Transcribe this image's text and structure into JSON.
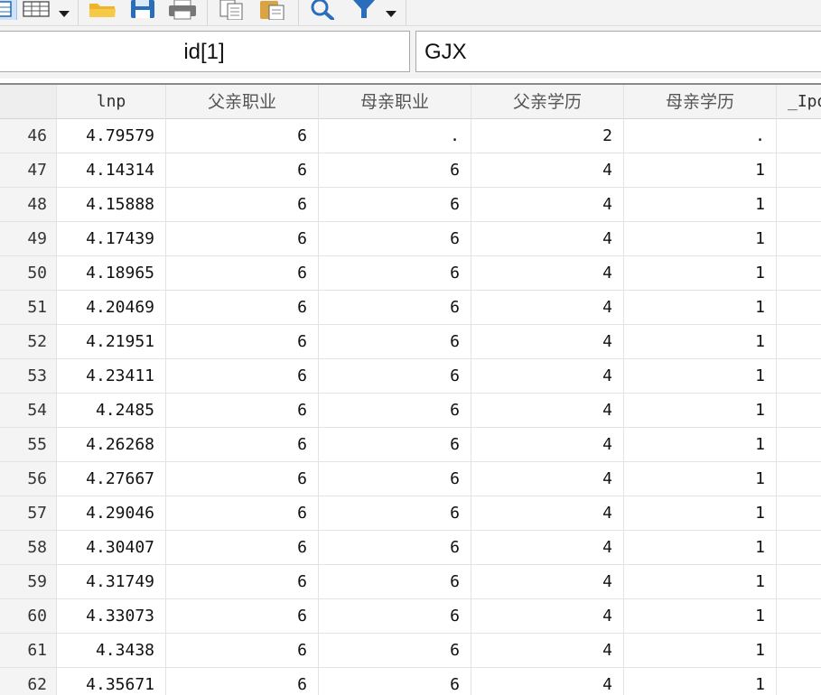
{
  "toolbar": {
    "icons": [
      "data-editor-icon",
      "table-view-icon",
      "dropdown-caret-icon",
      "open-folder-icon",
      "save-icon",
      "print-icon",
      "copy-icon",
      "paste-icon",
      "search-icon",
      "filter-icon",
      "dropdown-caret-icon"
    ]
  },
  "varname_box": {
    "value": "id[1]"
  },
  "value_box": {
    "value": "GJX"
  },
  "columns": [
    "",
    "lnp",
    "父亲职业",
    "母亲职业",
    "父亲学历",
    "母亲学历",
    "_Ipo"
  ],
  "rows": [
    {
      "n": "46",
      "lnp": "4.79579",
      "father_job": "6",
      "mother_job": ".",
      "father_edu": "2",
      "mother_edu": "."
    },
    {
      "n": "47",
      "lnp": "4.14314",
      "father_job": "6",
      "mother_job": "6",
      "father_edu": "4",
      "mother_edu": "1"
    },
    {
      "n": "48",
      "lnp": "4.15888",
      "father_job": "6",
      "mother_job": "6",
      "father_edu": "4",
      "mother_edu": "1"
    },
    {
      "n": "49",
      "lnp": "4.17439",
      "father_job": "6",
      "mother_job": "6",
      "father_edu": "4",
      "mother_edu": "1"
    },
    {
      "n": "50",
      "lnp": "4.18965",
      "father_job": "6",
      "mother_job": "6",
      "father_edu": "4",
      "mother_edu": "1"
    },
    {
      "n": "51",
      "lnp": "4.20469",
      "father_job": "6",
      "mother_job": "6",
      "father_edu": "4",
      "mother_edu": "1"
    },
    {
      "n": "52",
      "lnp": "4.21951",
      "father_job": "6",
      "mother_job": "6",
      "father_edu": "4",
      "mother_edu": "1"
    },
    {
      "n": "53",
      "lnp": "4.23411",
      "father_job": "6",
      "mother_job": "6",
      "father_edu": "4",
      "mother_edu": "1"
    },
    {
      "n": "54",
      "lnp": "4.2485",
      "father_job": "6",
      "mother_job": "6",
      "father_edu": "4",
      "mother_edu": "1"
    },
    {
      "n": "55",
      "lnp": "4.26268",
      "father_job": "6",
      "mother_job": "6",
      "father_edu": "4",
      "mother_edu": "1"
    },
    {
      "n": "56",
      "lnp": "4.27667",
      "father_job": "6",
      "mother_job": "6",
      "father_edu": "4",
      "mother_edu": "1"
    },
    {
      "n": "57",
      "lnp": "4.29046",
      "father_job": "6",
      "mother_job": "6",
      "father_edu": "4",
      "mother_edu": "1"
    },
    {
      "n": "58",
      "lnp": "4.30407",
      "father_job": "6",
      "mother_job": "6",
      "father_edu": "4",
      "mother_edu": "1"
    },
    {
      "n": "59",
      "lnp": "4.31749",
      "father_job": "6",
      "mother_job": "6",
      "father_edu": "4",
      "mother_edu": "1"
    },
    {
      "n": "60",
      "lnp": "4.33073",
      "father_job": "6",
      "mother_job": "6",
      "father_edu": "4",
      "mother_edu": "1"
    },
    {
      "n": "61",
      "lnp": "4.3438",
      "father_job": "6",
      "mother_job": "6",
      "father_edu": "4",
      "mother_edu": "1"
    },
    {
      "n": "62",
      "lnp": "4.35671",
      "father_job": "6",
      "mother_job": "6",
      "father_edu": "4",
      "mother_edu": "1"
    }
  ],
  "colors": {
    "accent_blue": "#2a6ebb",
    "folder_yellow": "#f0b429",
    "toolbar_bg": "#f3f3f3",
    "header_bg": "#f4f4f4"
  }
}
